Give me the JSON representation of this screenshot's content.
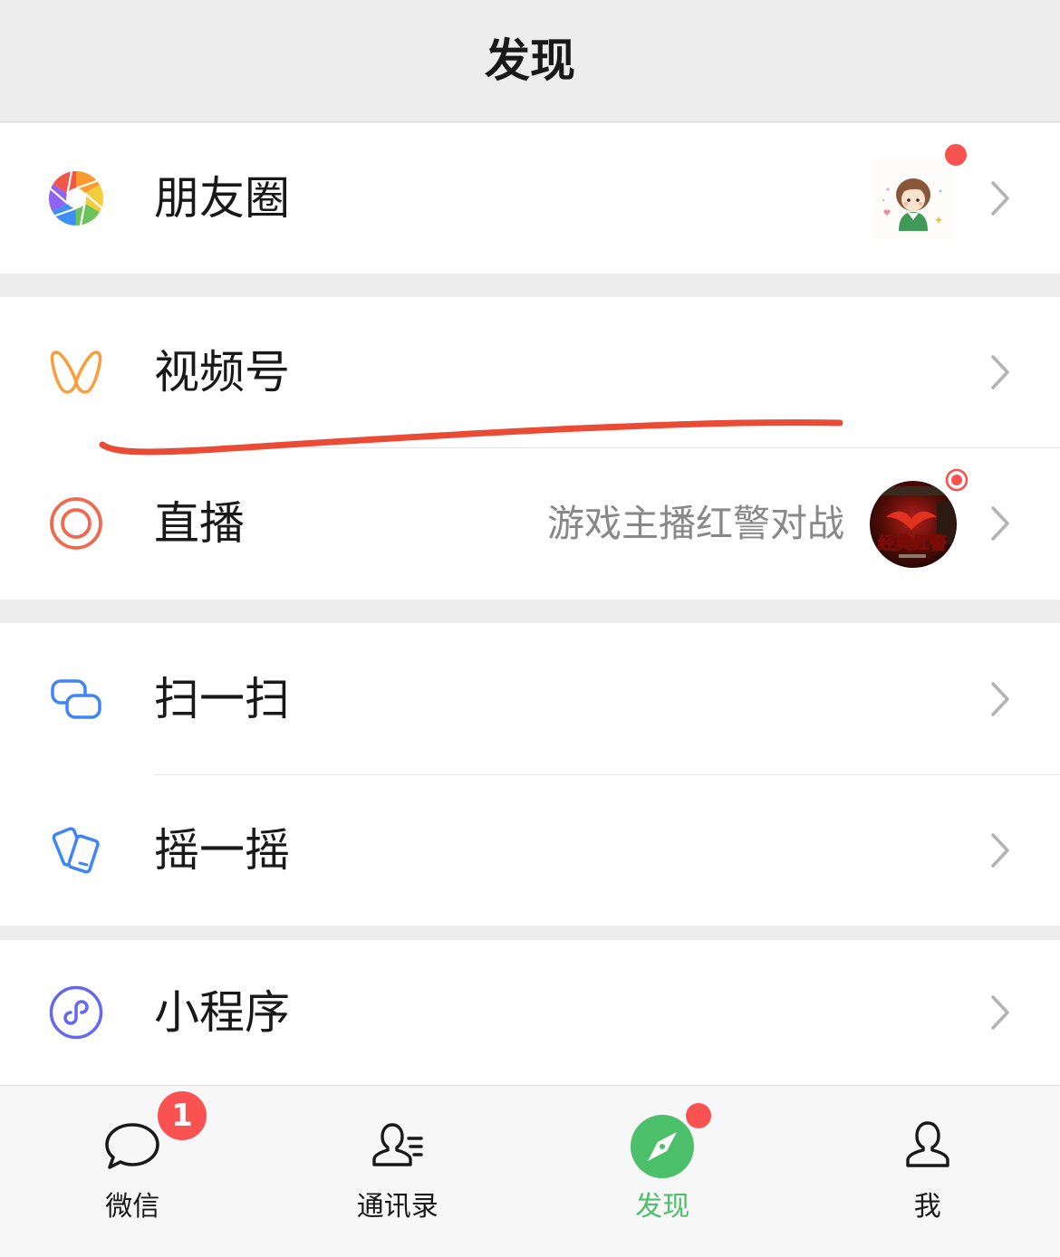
{
  "header": {
    "title": "发现"
  },
  "items": {
    "moments": {
      "label": "朋友圈",
      "icon": "moments-aperture-icon",
      "new_dot": true
    },
    "channels": {
      "label": "视频号",
      "icon": "channels-icon"
    },
    "live": {
      "label": "直播",
      "icon": "live-icon",
      "detail": "游戏主播红警对战",
      "thumbnail_text": "经典红警",
      "live_indicator": true
    },
    "scan": {
      "label": "扫一扫",
      "icon": "scan-icon"
    },
    "shake": {
      "label": "摇一摇",
      "icon": "shake-icon"
    },
    "mini_programs": {
      "label": "小程序",
      "icon": "mini-program-icon"
    }
  },
  "tabbar": {
    "tabs": [
      {
        "label": "微信",
        "icon": "chat-bubble-icon",
        "badge": "1"
      },
      {
        "label": "通讯录",
        "icon": "contacts-icon"
      },
      {
        "label": "发现",
        "icon": "compass-icon",
        "active": true,
        "dot": true
      },
      {
        "label": "我",
        "icon": "person-icon"
      }
    ]
  },
  "colors": {
    "background": "#ededed",
    "text": "#191919",
    "secondary_text": "#888888",
    "accent_green": "#4cbf6b",
    "badge_red": "#fa5151",
    "annotation_red": "#e94b35",
    "channels_orange": "#fa9d3b",
    "scan_blue": "#3f86f4",
    "mini_program_purple": "#6467f0"
  }
}
